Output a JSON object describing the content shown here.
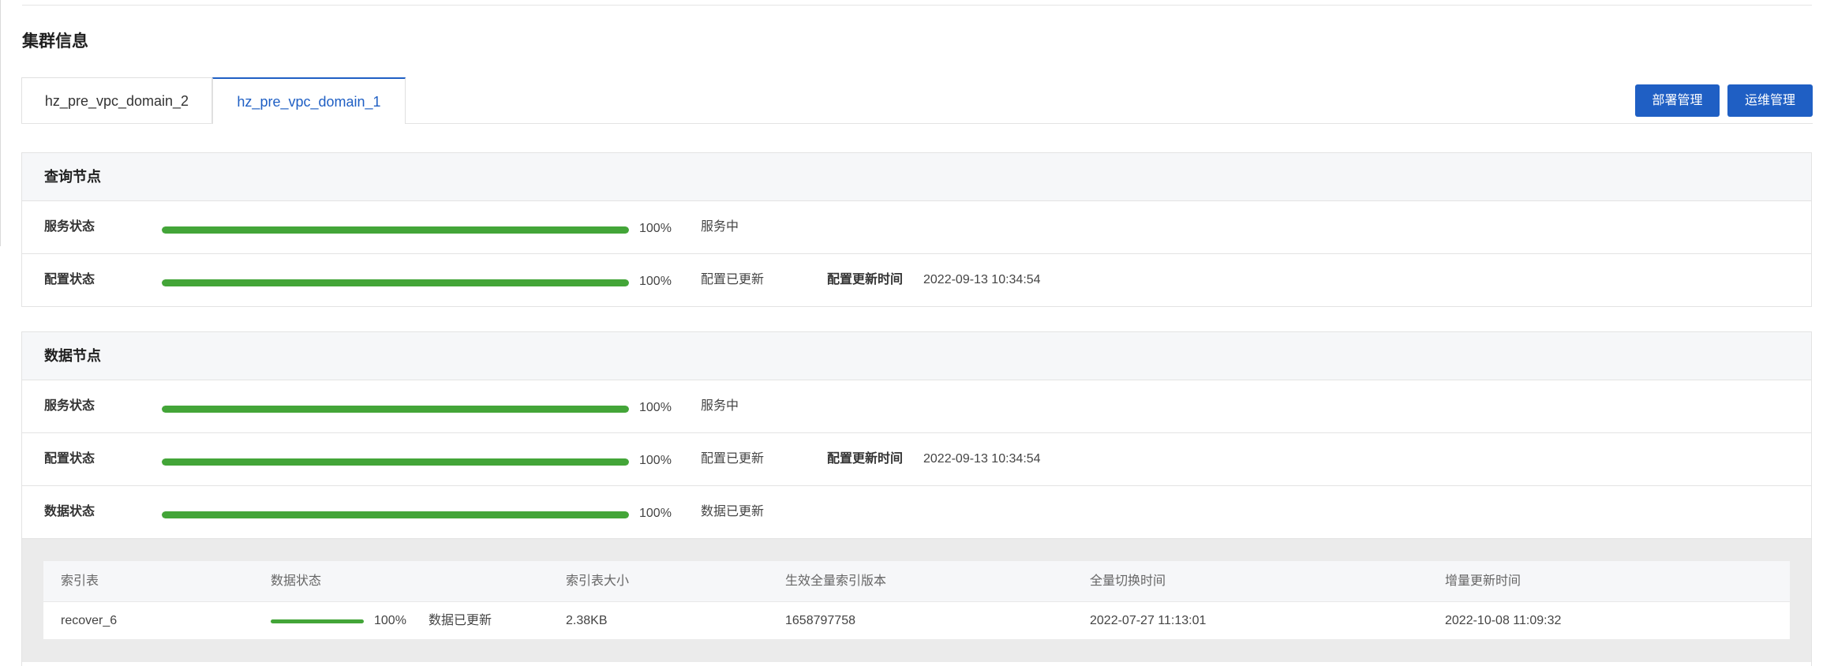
{
  "section_title": "集群信息",
  "tabs": [
    {
      "label": "hz_pre_vpc_domain_2",
      "active": false
    },
    {
      "label": "hz_pre_vpc_domain_1",
      "active": true
    }
  ],
  "buttons": {
    "deploy": "部署管理",
    "ops": "运维管理"
  },
  "colors": {
    "accent": "#1f5fc4",
    "progress": "#43a538"
  },
  "query_node": {
    "title": "查询节点",
    "rows": [
      {
        "label": "服务状态",
        "progress": 1.0,
        "percent": "100%",
        "status": "服务中"
      },
      {
        "label": "配置状态",
        "progress": 1.0,
        "percent": "100%",
        "status": "配置已更新",
        "time_label": "配置更新时间",
        "time_value": "2022-09-13 10:34:54"
      }
    ]
  },
  "data_node": {
    "title": "数据节点",
    "rows": [
      {
        "label": "服务状态",
        "progress": 1.0,
        "percent": "100%",
        "status": "服务中"
      },
      {
        "label": "配置状态",
        "progress": 1.0,
        "percent": "100%",
        "status": "配置已更新",
        "time_label": "配置更新时间",
        "time_value": "2022-09-13 10:34:54"
      },
      {
        "label": "数据状态",
        "progress": 1.0,
        "percent": "100%",
        "status": "数据已更新"
      }
    ],
    "index_table": {
      "headers": [
        "索引表",
        "数据状态",
        "索引表大小",
        "生效全量索引版本",
        "全量切换时间",
        "增量更新时间"
      ],
      "rows": [
        {
          "name": "recover_6",
          "progress": 1.0,
          "percent": "100%",
          "status": "数据已更新",
          "size": "2.38KB",
          "version": "1658797758",
          "full_switch_time": "2022-07-27 11:13:01",
          "incr_update_time": "2022-10-08 11:09:32"
        }
      ]
    }
  }
}
